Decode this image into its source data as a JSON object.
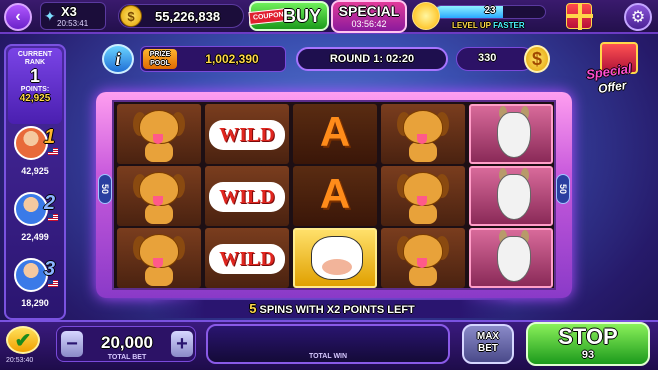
{
  "topbar": {
    "multiplier": "X3",
    "multiplier_timer": "20:53:41",
    "coins": "55,226,838",
    "coupon_label": "COUPON",
    "buy_label": "BUY",
    "special_label": "SPECIAL",
    "special_timer": "03:56:42",
    "level": "23",
    "level_progress_pct": 62,
    "level_caption_a": "LEVEL UP",
    "level_caption_b": "FASTER"
  },
  "info_icon": "i",
  "prize_pool": {
    "label_line1": "PRIZE",
    "label_line2": "POOL",
    "value": "1,002,390"
  },
  "round": "ROUND 1: 02:20",
  "points_pill": {
    "value": "330",
    "icon": "$"
  },
  "special_offer": {
    "line1": "Special",
    "line2": "Offer"
  },
  "leaderboard": {
    "current_rank_label_1": "CURRENT",
    "current_rank_label_2": "RANK",
    "rank": "1",
    "points_label": "POINTS:",
    "points": "42,925",
    "players": [
      {
        "rank": "1",
        "points": "42,925",
        "avatar_color": "#e86a3a"
      },
      {
        "rank": "2",
        "points": "22,499",
        "avatar_color": "#3a7ae8"
      },
      {
        "rank": "3",
        "points": "18,290",
        "avatar_color": "#3a7ae8"
      }
    ]
  },
  "reels": {
    "side_left": "50",
    "side_right": "50",
    "columns": [
      [
        "dog",
        "dog",
        "dog"
      ],
      [
        "wild",
        "wild",
        "wild"
      ],
      [
        "a",
        "a",
        "cow"
      ],
      [
        "dog",
        "dog",
        "dog"
      ],
      [
        "goat",
        "goat",
        "goat"
      ]
    ],
    "wild_label": "WILD",
    "a_label": "A"
  },
  "spins_left": {
    "count": "5",
    "text": "SPINS WITH X2 POINTS LEFT"
  },
  "bottom": {
    "check_timer": "20:53:40",
    "minus": "−",
    "plus": "+",
    "total_bet": "20,000",
    "total_bet_label": "TOTAL BET",
    "total_win_label": "TOTAL WIN",
    "max_bet_line1": "MAX",
    "max_bet_line2": "BET",
    "stop_label": "STOP",
    "stop_count": "93"
  }
}
